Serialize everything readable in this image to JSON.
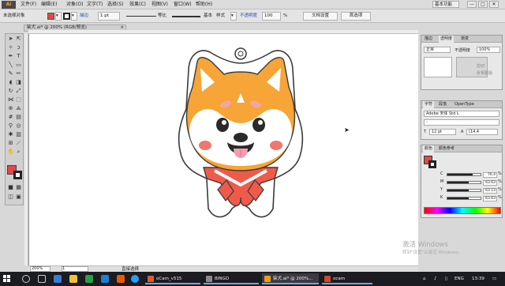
{
  "menubar": {
    "logo": "Ai",
    "menus": [
      "文件(F)",
      "编辑(E)",
      "对象(O)",
      "文字(T)",
      "选择(S)",
      "效果(C)",
      "视图(V)",
      "窗口(W)",
      "帮助(H)"
    ],
    "workspace": "基本功能",
    "window_buttons": [
      "—",
      "□",
      "✕"
    ]
  },
  "control_bar": {
    "selection_label": "未选择对象",
    "stroke_label": "描边",
    "stroke_weight": "1 pt",
    "uniform_label": "等比",
    "brush_label": "基本",
    "style_label": "样式",
    "opacity_label": "不透明度",
    "opacity_value": "100",
    "opacity_unit": "%",
    "doc_setup": "文档设置",
    "preferences": "首选项",
    "fill_color": "#e14848",
    "stroke_color": "#222222"
  },
  "document": {
    "tab": "柴犬.ai* @ 200% (RGB/预览)",
    "close": "×",
    "zoom": "200%",
    "page": "1",
    "current_tool": "直接选择"
  },
  "panels": {
    "transparency": {
      "tabs": [
        "描边",
        "透明度",
        "渐变"
      ],
      "blend_mode": "正常",
      "opacity_label": "不透明度",
      "opacity_value": "100%",
      "options": [
        "剪切",
        "反相蒙版"
      ]
    },
    "character": {
      "tabs": [
        "字符",
        "段落",
        "OpenType"
      ],
      "font_family": "Adobe 宋体 Std L",
      "font_style": "-",
      "size": "12 pt",
      "leading": "(14.4"
    },
    "color": {
      "tabs": [
        "颜色",
        "颜色参考"
      ],
      "channels": [
        {
          "label": "C",
          "value": "76.4",
          "unit": "%",
          "level": 0.764
        },
        {
          "label": "M",
          "value": "63.63",
          "unit": "%",
          "level": 0.6363
        },
        {
          "label": "Y",
          "value": "63.13",
          "unit": "%",
          "level": 0.6313
        },
        {
          "label": "K",
          "value": "63.63",
          "unit": "%",
          "level": 0.6363
        }
      ]
    }
  },
  "watermark": {
    "title": "激活 Windows",
    "subtitle": "转到\"设置\"以激活 Windows。"
  },
  "taskbar": {
    "apps": [
      {
        "label": "oCam_v515",
        "color": "#e05a2a"
      },
      {
        "label": "BINGO",
        "color": "#8a8a8a"
      },
      {
        "label": "柴犬.ai* @ 200%...",
        "color": "#f39c12"
      },
      {
        "label": "ocam",
        "color": "#d24726"
      }
    ],
    "language": "ENG",
    "time": "13:39"
  }
}
